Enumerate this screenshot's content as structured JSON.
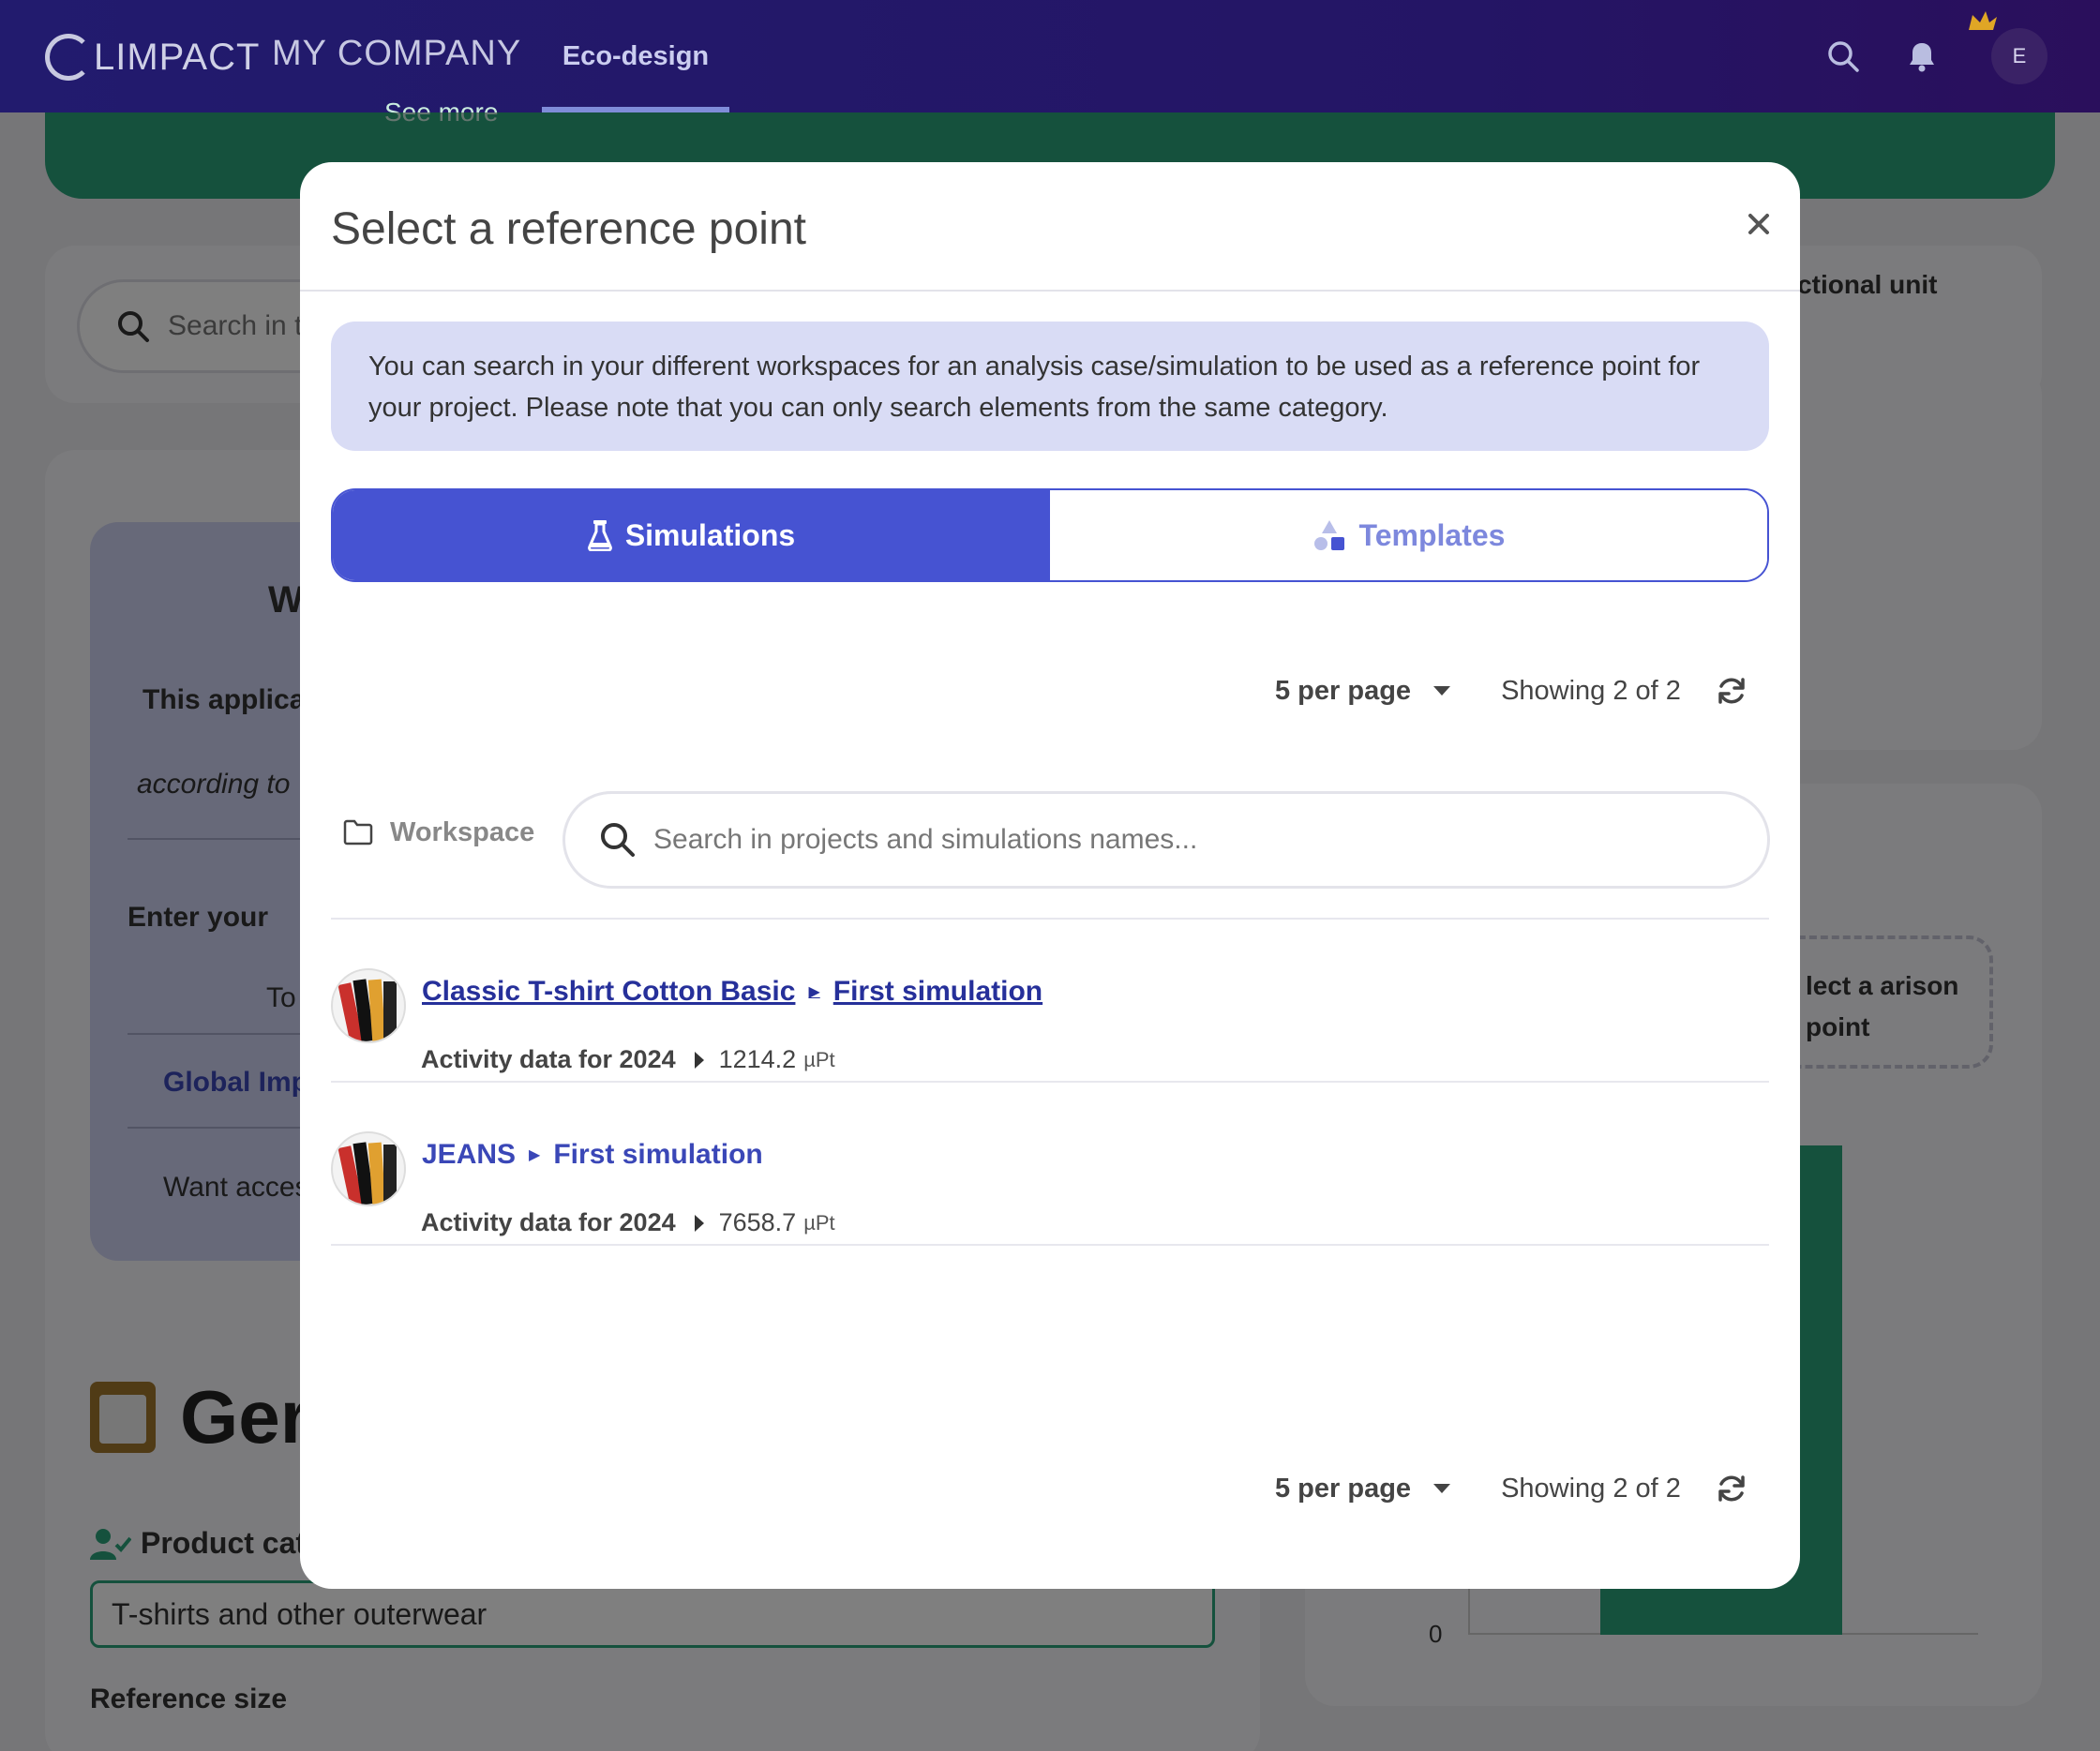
{
  "topbar": {
    "brand": "LIMPACT",
    "company": "MY COMPANY",
    "nav_active": "Eco-design",
    "avatar_initial": "E"
  },
  "background": {
    "see_more": "See more",
    "search_placeholder": "Search in t",
    "functional_unit": "nctional unit",
    "panel_heading": "W",
    "panel_bold": "This applica",
    "panel_italic": "according to",
    "panel_step": "Enter your",
    "panel_to": "To",
    "panel_global": "Global Imp",
    "panel_want": "Want acces",
    "general_title": "Ger",
    "product_category_label": "Product cat",
    "product_category_value": "T-shirts and other outerwear",
    "reference_size": "Reference size",
    "comparison_box": "lect a arison point",
    "chart_zero": "0"
  },
  "modal": {
    "title": "Select a reference point",
    "info": "You can search in your different workspaces for an analysis case/simulation to be used as a reference point for your project. Please note that you can only search elements from the same category.",
    "tabs": [
      {
        "label": "Simulations",
        "icon": "flask-icon",
        "active": true
      },
      {
        "label": "Templates",
        "icon": "shapes-icon",
        "active": false
      }
    ],
    "pager": {
      "per_page": "5 per page",
      "showing": "Showing 2 of 2"
    },
    "workspace_label": "Workspace",
    "search_placeholder": "Search in projects and simulations names...",
    "results": [
      {
        "project": "Classic T-shirt Cotton Basic",
        "simulation": "First simulation",
        "activity_label": "Activity data for 2024",
        "value": "1214.2",
        "unit": "µPt"
      },
      {
        "project": "JEANS",
        "simulation": "First simulation",
        "activity_label": "Activity data for 2024",
        "value": "7658.7",
        "unit": "µPt"
      }
    ]
  },
  "colors": {
    "primary": "#4653d2",
    "topbar": "#221b6e",
    "green": "#2aa37a",
    "info_bg": "#d9dcf5"
  }
}
